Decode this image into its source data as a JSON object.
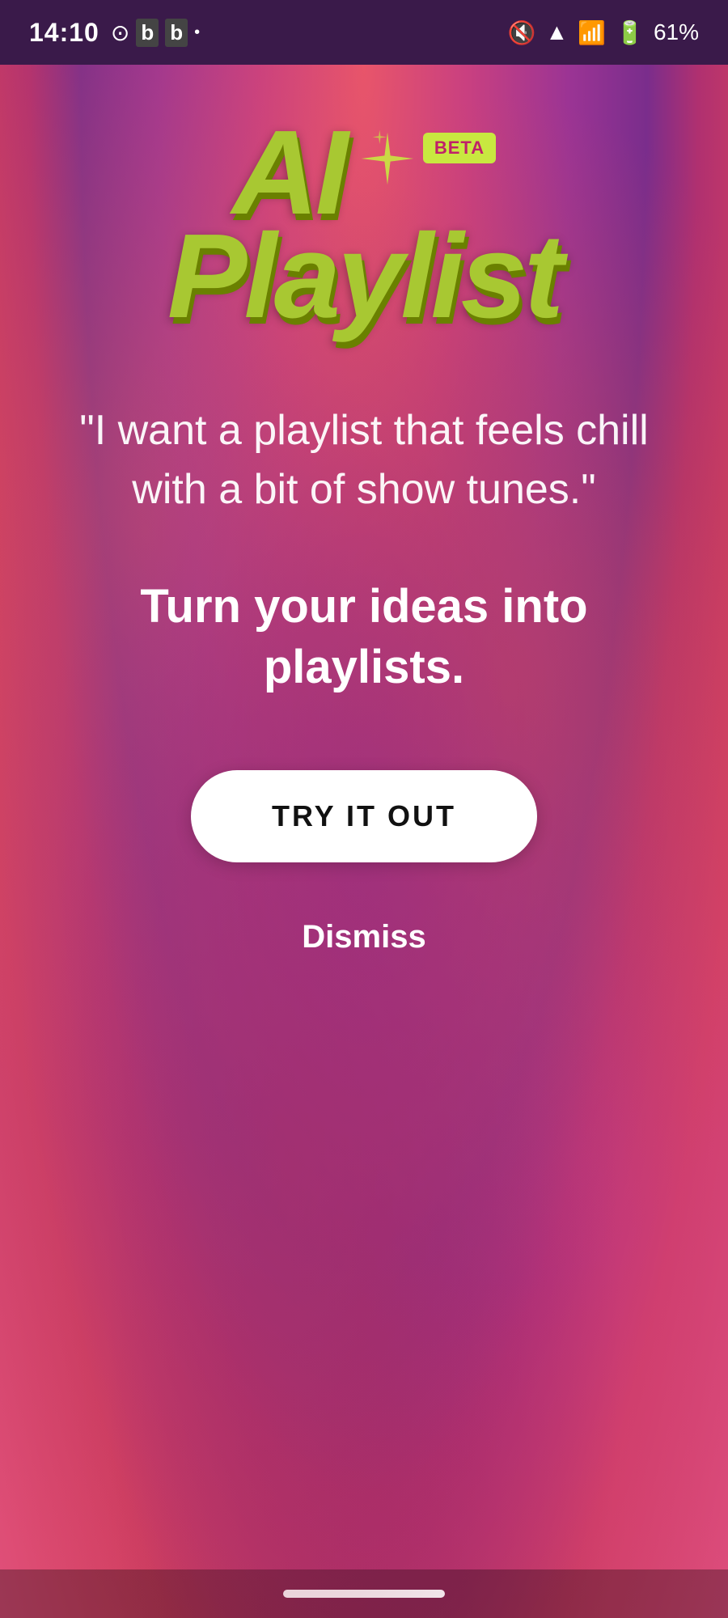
{
  "statusBar": {
    "time": "14:10",
    "battery": "61%",
    "icons": {
      "mute": "🔇",
      "wifi": "wifi-icon",
      "signal": "signal-icon",
      "battery": "battery-icon"
    }
  },
  "logo": {
    "ai": "AI",
    "playlist": "Playlist",
    "beta_label": "BETA",
    "sparkle": "✦"
  },
  "quote": {
    "text": "\"I want a playlist that feels chill with a bit of show tunes.\""
  },
  "tagline": {
    "text": "Turn your ideas into playlists."
  },
  "cta": {
    "try_button_label": "TRY IT OUT",
    "dismiss_label": "Dismiss"
  }
}
